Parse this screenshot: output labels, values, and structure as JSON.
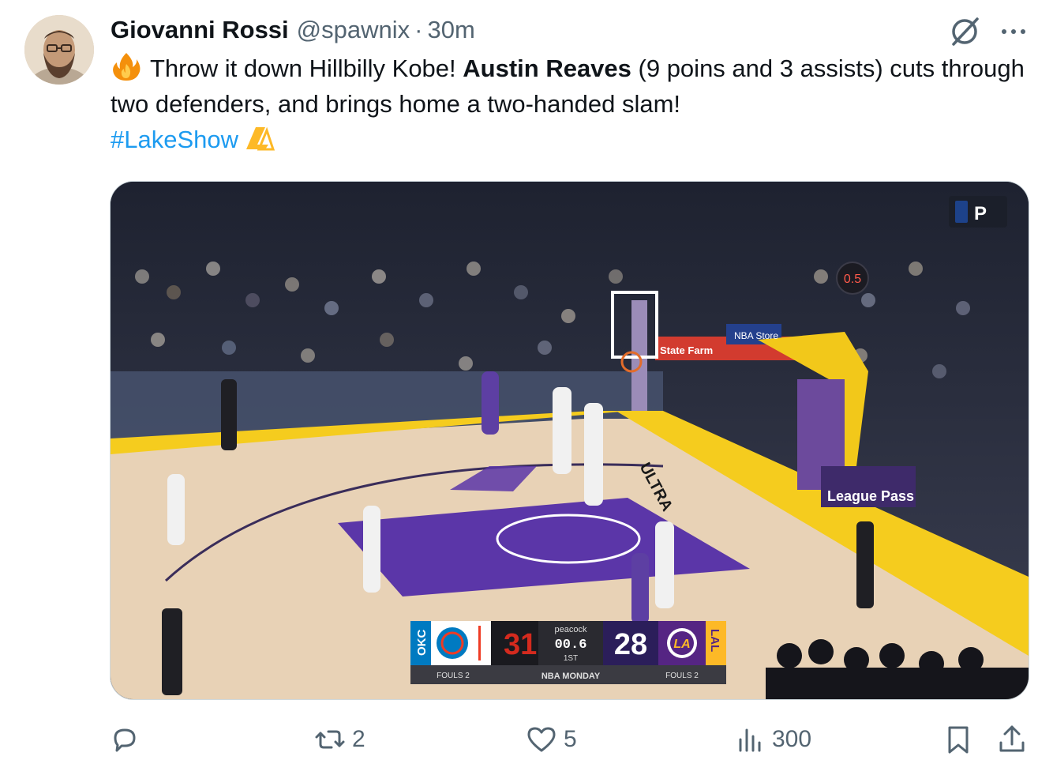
{
  "author": {
    "name": "Giovanni Rossi",
    "handle": "@spawnix",
    "separator": "·",
    "time": "30m"
  },
  "tweet": {
    "part1": "Throw it down Hillbilly Kobe! ",
    "bold": "Austin Reaves",
    "part2": " (9 poins and 3 assists) cuts through two defenders, and brings home a two-handed slam!",
    "hashtag": "#LakeShow"
  },
  "scorebug": {
    "home_abbr": "OKC",
    "home_score": "31",
    "broadcaster": "peacock",
    "clock": "00.6",
    "period": "1ST",
    "sponsor": "NBA MONDAY",
    "away_score": "28",
    "away_abbr": "LAL",
    "fouls_left": "FOULS 2",
    "fouls_right": "FOULS 2"
  },
  "court_signage": {
    "ultra": "ULTRA",
    "statefarm": "State Farm",
    "nba_store": "NBA Store",
    "league_pass": "League Pass",
    "shot_clock": "0.5"
  },
  "actions": {
    "reply_count": "",
    "retweet_count": "2",
    "like_count": "5",
    "views_count": "300"
  },
  "icons": {
    "grok": "grok-icon",
    "more": "more-icon",
    "reply": "reply-icon",
    "retweet": "retweet-icon",
    "like": "heart-icon",
    "views": "views-icon",
    "bookmark": "bookmark-icon",
    "share": "share-icon"
  },
  "colors": {
    "hashtag": "#1d9bf0",
    "secondary_text": "#536471",
    "lakers_purple": "#552583",
    "lakers_gold": "#fdb927",
    "okc_blue": "#007ac1"
  }
}
